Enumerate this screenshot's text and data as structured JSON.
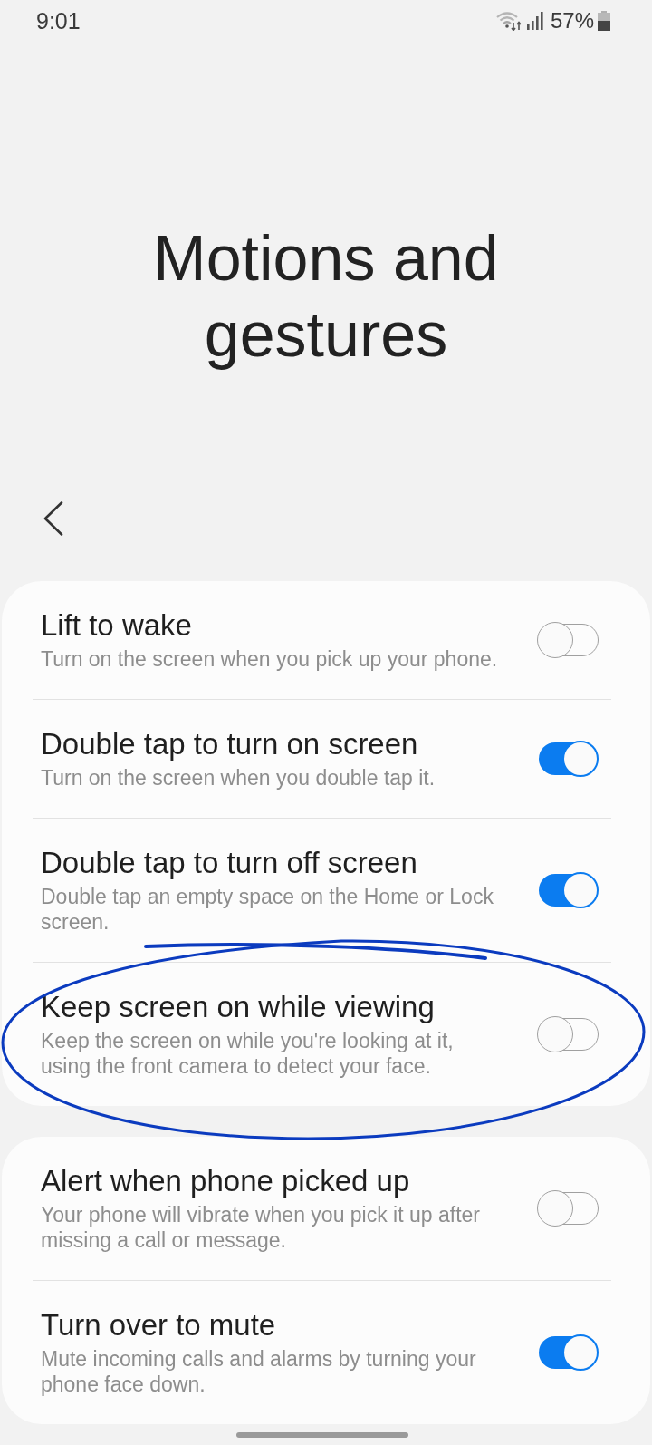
{
  "status_bar": {
    "time": "9:01",
    "battery": "57%"
  },
  "header": {
    "title": "Motions and gestures"
  },
  "groups": [
    {
      "items": [
        {
          "title": "Lift to wake",
          "description": "Turn on the screen when you pick up your phone.",
          "on": false
        },
        {
          "title": "Double tap to turn on screen",
          "description": "Turn on the screen when you double tap it.",
          "on": true
        },
        {
          "title": "Double tap to turn off screen",
          "description": "Double tap an empty space on the Home or Lock screen.",
          "on": true
        },
        {
          "title": "Keep screen on while viewing",
          "description": "Keep the screen on while you're looking at it, using the front camera to detect your face.",
          "on": false
        }
      ]
    },
    {
      "items": [
        {
          "title": "Alert when phone picked up",
          "description": "Your phone will vibrate when you pick it up after missing a call or message.",
          "on": false
        },
        {
          "title": "Turn over to mute",
          "description": "Mute incoming calls and alarms by turning your phone face down.",
          "on": true
        }
      ]
    }
  ]
}
